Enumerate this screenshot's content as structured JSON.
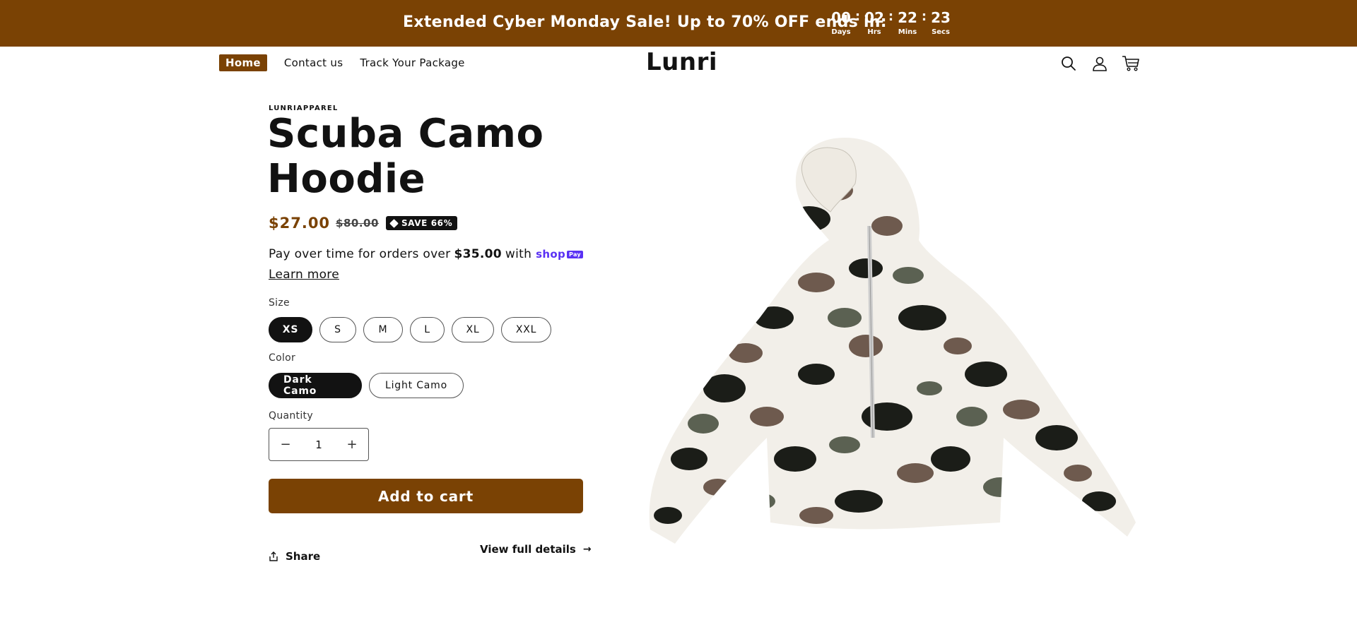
{
  "announcement": {
    "text": "Extended Cyber Monday Sale! Up to 70% OFF ends in:",
    "countdown": [
      {
        "value": "00",
        "label": "Days"
      },
      {
        "value": "02",
        "label": "Hrs"
      },
      {
        "value": "22",
        "label": "Mins"
      },
      {
        "value": "23",
        "label": "Secs"
      }
    ],
    "separator": ":"
  },
  "header": {
    "nav": [
      {
        "label": "Home",
        "active": true
      },
      {
        "label": "Contact us",
        "active": false
      },
      {
        "label": "Track Your Package",
        "active": false
      }
    ],
    "logo": "Lunri",
    "icons": [
      "search-icon",
      "account-icon",
      "cart-icon"
    ]
  },
  "product": {
    "vendor": "LUNRIAPPAREL",
    "title": "Scuba Camo Hoodie",
    "price_sale": "$27.00",
    "price_regular": "$80.00",
    "badge": "SAVE 66%",
    "installments": {
      "prefix": "Pay over time for orders over",
      "amount": "$35.00",
      "suffix": "with",
      "provider": "shop",
      "provider_badge": "Pay"
    },
    "learn_more": "Learn more",
    "size": {
      "label": "Size",
      "options": [
        "XS",
        "S",
        "M",
        "L",
        "XL",
        "XXL"
      ],
      "selected": "XS"
    },
    "color": {
      "label": "Color",
      "options": [
        "Dark Camo",
        "Light Camo"
      ],
      "selected": "Dark Camo"
    },
    "quantity": {
      "label": "Quantity",
      "value": "1",
      "decrease": "−",
      "increase": "+"
    },
    "add_to_cart": "Add to cart",
    "share": "Share",
    "view_details": "View full details",
    "view_details_arrow": "→"
  },
  "colors": {
    "brand": "#7a4204",
    "selected_pill": "#121212",
    "shop_pay": "#5a31f4"
  }
}
